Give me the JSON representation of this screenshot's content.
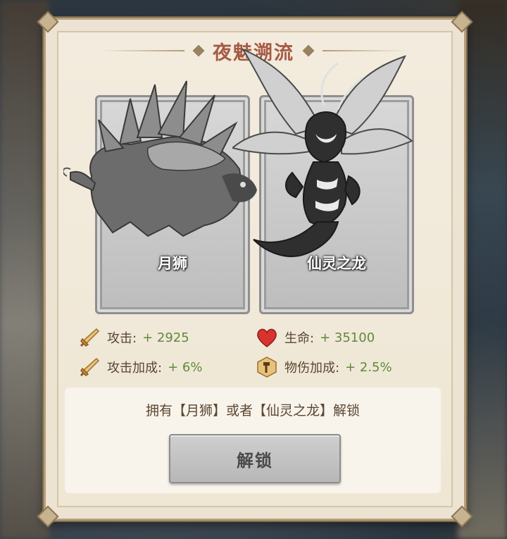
{
  "dialog": {
    "title": "夜魅溯流",
    "cards": [
      {
        "name": "月狮",
        "icon": "moon-lion-creature"
      },
      {
        "name": "仙灵之龙",
        "icon": "fairy-dragon-creature"
      }
    ],
    "stats": {
      "attack": {
        "label": "攻击:",
        "value": "+ 2925",
        "icon": "sword-icon"
      },
      "hp": {
        "label": "生命:",
        "value": "+ 35100",
        "icon": "heart-icon"
      },
      "attack_bonus": {
        "label": "攻击加成:",
        "value": "+ 6%",
        "icon": "sword-icon"
      },
      "phys_dmg_bonus": {
        "label": "物伤加成:",
        "value": "+ 2.5%",
        "icon": "hammer-shield-icon"
      }
    },
    "unlock_condition": "拥有【月狮】或者【仙灵之龙】解锁",
    "unlock_button": "解锁"
  },
  "colors": {
    "title": "#a65a44",
    "stat_value": "#5f8a3a",
    "heart": "#d8332f"
  }
}
